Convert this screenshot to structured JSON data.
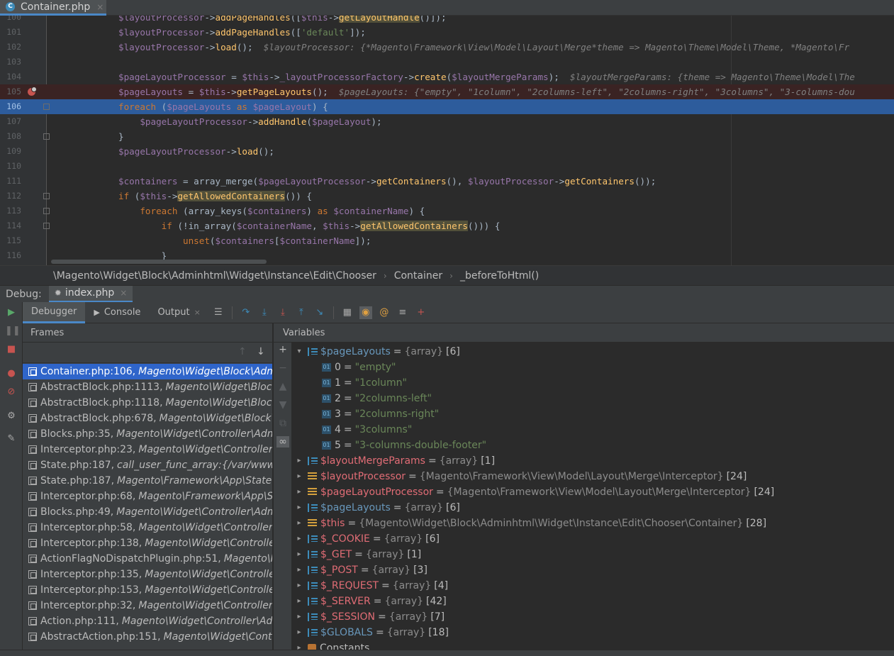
{
  "editor_tab": {
    "icon": "C",
    "label": "Container.php",
    "close": "×"
  },
  "code_lines": [
    {
      "n": "100",
      "html": "<span class=\"v\">$layoutProcessor</span>-><span class=\"f\">addPageHandles</span>([<span class=\"v\">$this</span>-><span class=\"h\">getLayoutHandle</span>()]);"
    },
    {
      "n": "101",
      "html": "<span class=\"v\">$layoutProcessor</span>-><span class=\"f\">addPageHandles</span>([<span class=\"s\">'default'</span>]);"
    },
    {
      "n": "102",
      "html": "<span class=\"v\">$layoutProcessor</span>-><span class=\"f\">load</span>();  <span class=\"c\">$layoutProcessor: {*Magento\\Framework\\View\\Model\\Layout\\Merge*theme => Magento\\Theme\\Model\\Theme, *Magento\\Fr</span>"
    },
    {
      "n": "103",
      "html": ""
    },
    {
      "n": "104",
      "html": "<span class=\"v\">$pageLayoutProcessor</span> = <span class=\"v\">$this</span>-><span class=\"v\">_layoutProcessorFactory</span>-><span class=\"f\">create</span>(<span class=\"v\">$layoutMergeParams</span>);  <span class=\"c\">$layoutMergeParams: {theme => Magento\\Theme\\Model\\The</span>"
    },
    {
      "n": "105",
      "html": "<span class=\"v\">$pageLayouts</span> = <span class=\"v\">$this</span>-><span class=\"f\">getPageLayouts</span>();  <span class=\"c\">$pageLayouts: {\"empty\", \"1column\", \"2columns-left\", \"2columns-right\", \"3columns\", \"3-columns-dou</span>"
    },
    {
      "n": "106",
      "html": "<span class=\"k\">foreach</span> (<span class=\"v\">$pageLayouts</span> <span class=\"k\">as</span> <span class=\"v\">$pageLayout</span>) {"
    },
    {
      "n": "107",
      "html": "    <span class=\"v\">$pageLayoutProcessor</span>-><span class=\"f\">addHandle</span>(<span class=\"v\">$pageLayout</span>);"
    },
    {
      "n": "108",
      "html": "}"
    },
    {
      "n": "109",
      "html": "<span class=\"v\">$pageLayoutProcessor</span>-><span class=\"f\">load</span>();"
    },
    {
      "n": "110",
      "html": ""
    },
    {
      "n": "111",
      "html": "<span class=\"v\">$containers</span> = array_merge(<span class=\"v\">$pageLayoutProcessor</span>-><span class=\"f\">getContainers</span>(), <span class=\"v\">$layoutProcessor</span>-><span class=\"f\">getContainers</span>());"
    },
    {
      "n": "112",
      "html": "<span class=\"k\">if</span> (<span class=\"v\">$this</span>-><span class=\"h\">getAllowedContainers</span>()) {"
    },
    {
      "n": "113",
      "html": "    <span class=\"k\">foreach</span> (array_keys(<span class=\"v\">$containers</span>) <span class=\"k\">as</span> <span class=\"v\">$containerName</span>) {"
    },
    {
      "n": "114",
      "html": "        <span class=\"k\">if</span> (!in_array(<span class=\"v\">$containerName</span>, <span class=\"v\">$this</span>-><span class=\"h\">getAllowedContainers</span>())) {"
    },
    {
      "n": "115",
      "html": "            <span class=\"k\">unset</span>(<span class=\"v\">$containers</span>[<span class=\"v\">$containerName</span>]);"
    },
    {
      "n": "116",
      "html": "        }"
    }
  ],
  "breadcrumb": [
    "\\Magento\\Widget\\Block\\Adminhtml\\Widget\\Instance\\Edit\\Chooser",
    "Container",
    "_beforeToHtml()"
  ],
  "debug": {
    "title": "Debug:",
    "session_tab": "index.php",
    "tabs": [
      "Debugger",
      "Console",
      "Output"
    ],
    "frames_header": "Frames",
    "variables_header": "Variables"
  },
  "frames": [
    {
      "file": "Container.php:106,",
      "cls": "Magento\\Widget\\Block\\Adminhtml"
    },
    {
      "file": "AbstractBlock.php:1113,",
      "cls": "Magento\\Widget\\Block\\Adminhtml"
    },
    {
      "file": "AbstractBlock.php:1118,",
      "cls": "Magento\\Widget\\Block\\Adminhtml"
    },
    {
      "file": "AbstractBlock.php:678,",
      "cls": "Magento\\Widget\\Block\\Adminhtml"
    },
    {
      "file": "Blocks.php:35,",
      "cls": "Magento\\Widget\\Controller\\Adminhtml"
    },
    {
      "file": "Interceptor.php:23,",
      "cls": "Magento\\Widget\\Controller\\Adminhtml"
    },
    {
      "file": "State.php:187,",
      "cls": "call_user_func_array:{/var/www/html"
    },
    {
      "file": "State.php:187,",
      "cls": "Magento\\Framework\\App\\State\\Interceptor"
    },
    {
      "file": "Interceptor.php:68,",
      "cls": "Magento\\Framework\\App\\State\\Interceptor"
    },
    {
      "file": "Blocks.php:49,",
      "cls": "Magento\\Widget\\Controller\\Adminhtml"
    },
    {
      "file": "Interceptor.php:58,",
      "cls": "Magento\\Widget\\Controller\\Adminhtml"
    },
    {
      "file": "Interceptor.php:138,",
      "cls": "Magento\\Widget\\Controller\\Adminhtml"
    },
    {
      "file": "ActionFlagNoDispatchPlugin.php:51,",
      "cls": "Magento\\Framework"
    },
    {
      "file": "Interceptor.php:135,",
      "cls": "Magento\\Widget\\Controller\\Adminhtml"
    },
    {
      "file": "Interceptor.php:153,",
      "cls": "Magento\\Widget\\Controller\\Adminhtml"
    },
    {
      "file": "Interceptor.php:32,",
      "cls": "Magento\\Widget\\Controller\\Adminhtml"
    },
    {
      "file": "Action.php:111,",
      "cls": "Magento\\Widget\\Controller\\Adminhtml"
    },
    {
      "file": "AbstractAction.php:151,",
      "cls": "Magento\\Widget\\Controller\\Adminhtml"
    }
  ],
  "variables": [
    {
      "indent": 0,
      "arrow": "▾",
      "icon": "arr",
      "name": "$pageLayouts",
      "nc": "blue",
      "type": "{array}",
      "count": "[6]"
    },
    {
      "indent": 1,
      "arrow": "",
      "icon": "idx",
      "name": "0",
      "nc": "plain",
      "sval": "\"empty\""
    },
    {
      "indent": 1,
      "arrow": "",
      "icon": "idx",
      "name": "1",
      "nc": "plain",
      "sval": "\"1column\""
    },
    {
      "indent": 1,
      "arrow": "",
      "icon": "idx",
      "name": "2",
      "nc": "plain",
      "sval": "\"2columns-left\""
    },
    {
      "indent": 1,
      "arrow": "",
      "icon": "idx",
      "name": "3",
      "nc": "plain",
      "sval": "\"2columns-right\""
    },
    {
      "indent": 1,
      "arrow": "",
      "icon": "idx",
      "name": "4",
      "nc": "plain",
      "sval": "\"3columns\""
    },
    {
      "indent": 1,
      "arrow": "",
      "icon": "idx",
      "name": "5",
      "nc": "plain",
      "sval": "\"3-columns-double-footer\""
    },
    {
      "indent": 0,
      "arrow": "▸",
      "icon": "arr",
      "name": "$layoutMergeParams",
      "nc": "red",
      "type": "{array}",
      "count": "[1]"
    },
    {
      "indent": 0,
      "arrow": "▸",
      "icon": "obj",
      "name": "$layoutProcessor",
      "nc": "red",
      "type": "{Magento\\Framework\\View\\Model\\Layout\\Merge\\Interceptor}",
      "count": "[24]"
    },
    {
      "indent": 0,
      "arrow": "▸",
      "icon": "obj",
      "name": "$pageLayoutProcessor",
      "nc": "red",
      "type": "{Magento\\Framework\\View\\Model\\Layout\\Merge\\Interceptor}",
      "count": "[24]"
    },
    {
      "indent": 0,
      "arrow": "▸",
      "icon": "arr",
      "name": "$pageLayouts",
      "nc": "blue",
      "type": "{array}",
      "count": "[6]"
    },
    {
      "indent": 0,
      "arrow": "▸",
      "icon": "obj",
      "name": "$this",
      "nc": "red",
      "type": "{Magento\\Widget\\Block\\Adminhtml\\Widget\\Instance\\Edit\\Chooser\\Container}",
      "count": "[28]"
    },
    {
      "indent": 0,
      "arrow": "▸",
      "icon": "arr",
      "name": "$_COOKIE",
      "nc": "red",
      "type": "{array}",
      "count": "[6]"
    },
    {
      "indent": 0,
      "arrow": "▸",
      "icon": "arr",
      "name": "$_GET",
      "nc": "red",
      "type": "{array}",
      "count": "[1]"
    },
    {
      "indent": 0,
      "arrow": "▸",
      "icon": "arr",
      "name": "$_POST",
      "nc": "red",
      "type": "{array}",
      "count": "[3]"
    },
    {
      "indent": 0,
      "arrow": "▸",
      "icon": "arr",
      "name": "$_REQUEST",
      "nc": "red",
      "type": "{array}",
      "count": "[4]"
    },
    {
      "indent": 0,
      "arrow": "▸",
      "icon": "arr",
      "name": "$_SERVER",
      "nc": "red",
      "type": "{array}",
      "count": "[42]"
    },
    {
      "indent": 0,
      "arrow": "▸",
      "icon": "arr",
      "name": "$_SESSION",
      "nc": "red",
      "type": "{array}",
      "count": "[7]"
    },
    {
      "indent": 0,
      "arrow": "▸",
      "icon": "arr",
      "name": "$GLOBALS",
      "nc": "blue",
      "type": "{array}",
      "count": "[18]"
    },
    {
      "indent": 0,
      "arrow": "▸",
      "icon": "con",
      "name": "Constants",
      "nc": "plain",
      "type": "",
      "count": ""
    }
  ]
}
